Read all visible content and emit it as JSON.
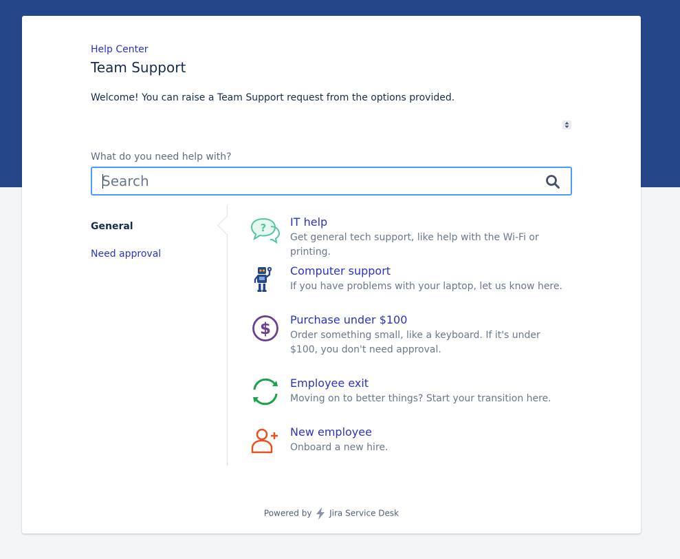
{
  "breadcrumb": "Help Center",
  "page_title": "Team Support",
  "welcome_text": "Welcome! You can raise a Team Support request from the options provided.",
  "search": {
    "label": "What do you need help with?",
    "placeholder": "Search",
    "value": ""
  },
  "nav": {
    "items": [
      {
        "label": "General",
        "active": true
      },
      {
        "label": "Need approval",
        "active": false
      }
    ]
  },
  "request_types": [
    {
      "name": "IT help",
      "description": "Get general tech support, like help with the Wi-Fi or printing.",
      "icon": "chat-question-icon",
      "color": "#4fc7a0"
    },
    {
      "name": "Computer support",
      "description": "If you have problems with your laptop, let us know here.",
      "icon": "robot-icon",
      "color": "#26468a"
    },
    {
      "name": "Purchase under $100",
      "description": "Order something small, like a keyboard. If it's under $100, you don't need approval.",
      "icon": "dollar-icon",
      "color": "#6b3f8f"
    },
    {
      "name": "Employee exit",
      "description": "Moving on to better things? Start your transition here.",
      "icon": "refresh-arrows-icon",
      "color": "#16a34a"
    },
    {
      "name": "New employee",
      "description": "Onboard a new hire.",
      "icon": "add-user-icon",
      "color": "#e8501d"
    }
  ],
  "footer": {
    "powered_by": "Powered by",
    "product": "Jira Service Desk"
  },
  "colors": {
    "banner": "#26468a",
    "link": "#2a33c4",
    "focus": "#4c9aff"
  }
}
